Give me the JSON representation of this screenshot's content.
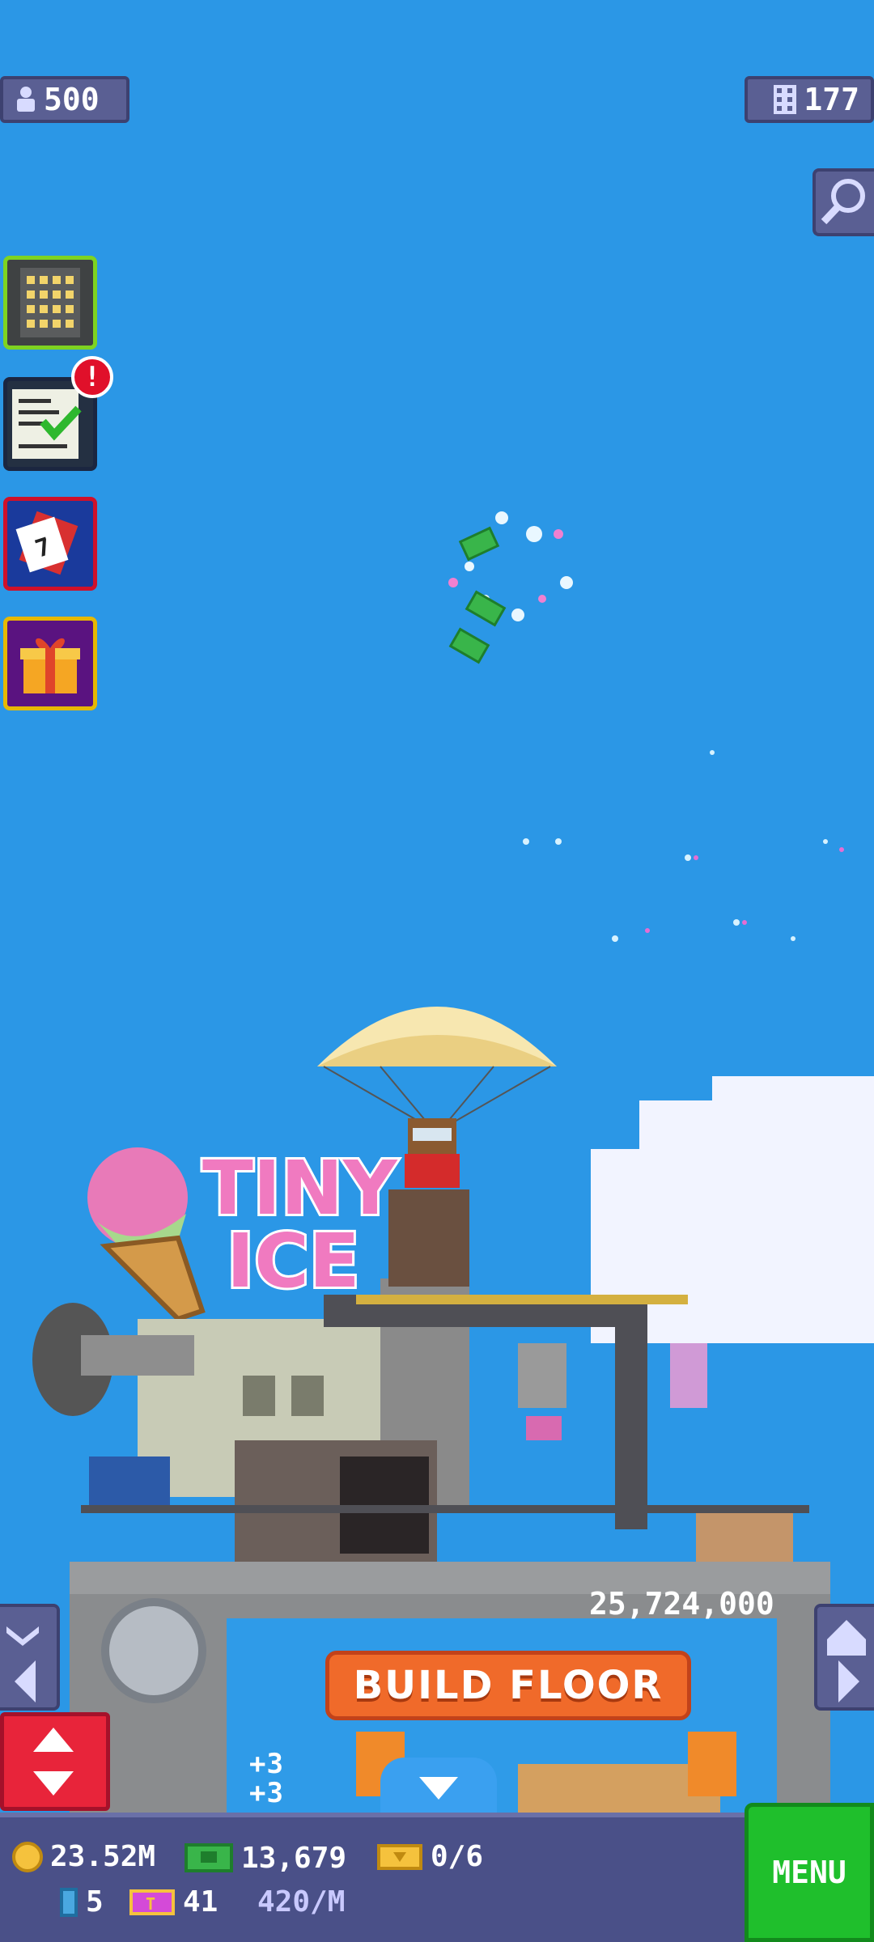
{
  "hud": {
    "population": "500",
    "floors": "177"
  },
  "sign": {
    "logo_line1": "TINY",
    "logo_line2": "ICE"
  },
  "build": {
    "cost": "25,724,000",
    "label": "BUILD FLOOR"
  },
  "bottom": {
    "coins": "23.52M",
    "bux": "13,679",
    "vip_tickets": "0/6",
    "plus_label_1": "+3",
    "plus_label_2": "+3",
    "tokens": "5",
    "tickets": "41",
    "rate": "420/M",
    "menu": "MENU"
  },
  "notifications": {
    "missions_badge": "!"
  },
  "colors": {
    "sky": "#2b97e6",
    "hud_bg": "#5a5f93",
    "build_button": "#f06a2a",
    "menu_button": "#1fbf2c",
    "elevator_button": "#e8243a"
  },
  "icons": [
    "person-icon",
    "building-grid-icon",
    "magnifier-icon",
    "building-icon",
    "missions-icon",
    "calendar-icon",
    "gift-icon",
    "coin-icon",
    "bux-icon",
    "vip-ticket-icon",
    "token-icon",
    "ticket-icon",
    "elevator-icon",
    "parachute-icon",
    "chevron-down-icon"
  ]
}
